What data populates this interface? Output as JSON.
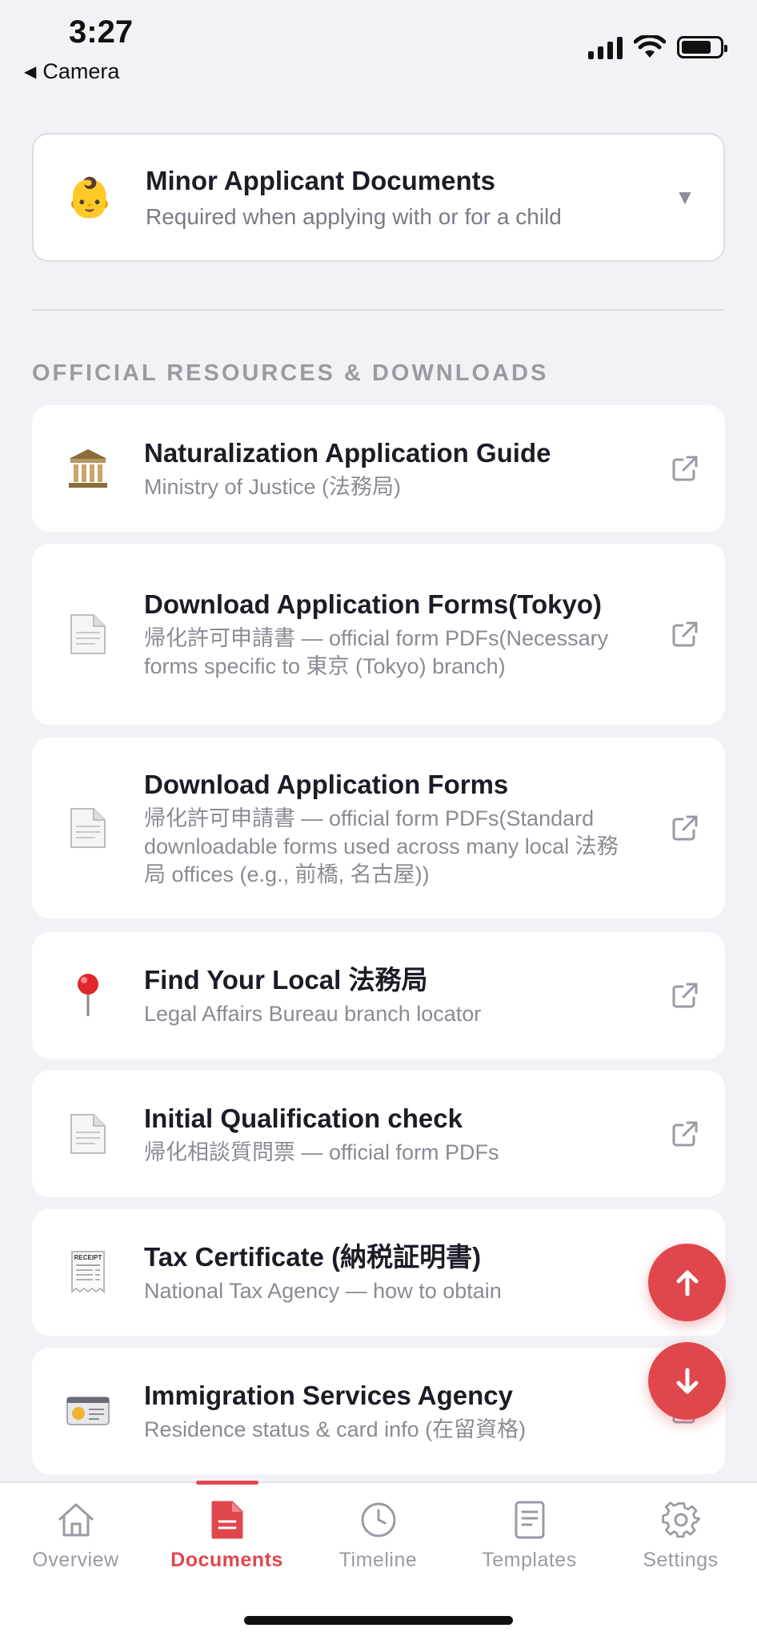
{
  "status_bar": {
    "time": "3:27",
    "back_app": "Camera"
  },
  "minor_card": {
    "emoji": "👶",
    "title": "Minor Applicant Documents",
    "subtitle": "Required when applying with or for a child",
    "caret": "▼"
  },
  "section_title": "OFFICIAL RESOURCES & DOWNLOADS",
  "resources": [
    {
      "icon": "bank-building-icon",
      "title": "Naturalization Application Guide",
      "subtitle": "Ministry of Justice (法務局)"
    },
    {
      "icon": "document-icon",
      "title": "Download Application Forms(Tokyo)",
      "subtitle": "帰化許可申請書 — official form PDFs(Necessary forms specific to 東京 (Tokyo) branch)"
    },
    {
      "icon": "document-icon",
      "title": "Download Application Forms",
      "subtitle": "帰化許可申請書 — official form PDFs(Standard downloadable forms used across many local 法務局 offices (e.g., 前橋, 名古屋))"
    },
    {
      "icon": "map-pin-icon",
      "title": "Find Your Local 法務局",
      "subtitle": "Legal Affairs Bureau branch locator"
    },
    {
      "icon": "document-icon",
      "title": "Initial Qualification check",
      "subtitle": "帰化相談質問票 — official form PDFs"
    },
    {
      "icon": "receipt-icon",
      "title": "Tax Certificate (納税証明書)",
      "subtitle": "National Tax Agency — how to obtain",
      "receipt_text": "RECEIPT"
    },
    {
      "icon": "id-card-icon",
      "title": "Immigration Services Agency",
      "subtitle": "Residence status & card info (在留資格)"
    }
  ],
  "tabs": [
    {
      "label": "Overview",
      "icon": "home-icon",
      "active": false
    },
    {
      "label": "Documents",
      "icon": "document-icon",
      "active": true
    },
    {
      "label": "Timeline",
      "icon": "clock-icon",
      "active": false
    },
    {
      "label": "Templates",
      "icon": "template-icon",
      "active": false
    },
    {
      "label": "Settings",
      "icon": "gear-icon",
      "active": false
    }
  ],
  "colors": {
    "accent": "#e0474c",
    "background": "#f2f2f6",
    "muted_text": "#9a9aa6"
  }
}
